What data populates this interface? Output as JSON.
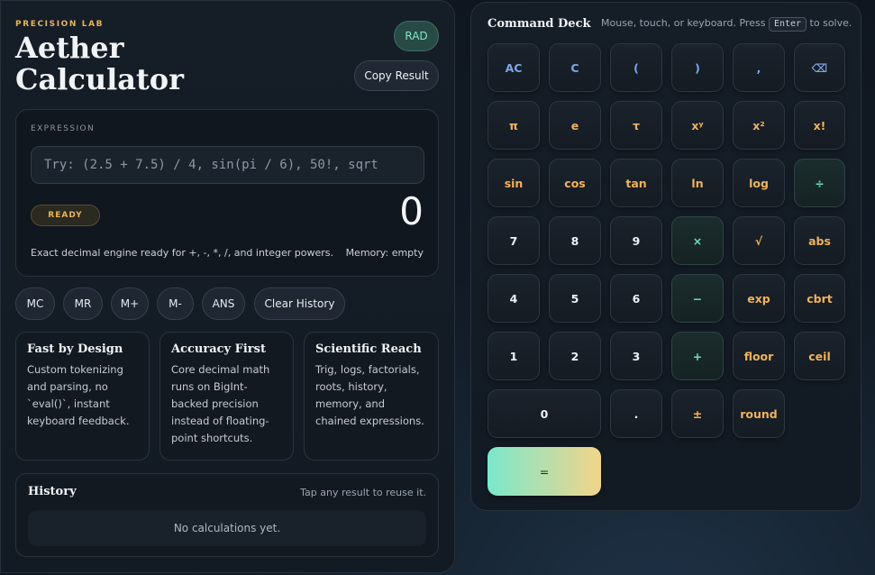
{
  "header": {
    "eyebrow": "PRECISION LAB",
    "title_line1": "Aether",
    "title_line2": "Calculator",
    "angle_mode": "RAD",
    "copy_label": "Copy Result"
  },
  "expression": {
    "label": "EXPRESSION",
    "placeholder": "Try: (2.5 + 7.5) / 4, sin(pi / 6), 50!, sqrt",
    "value": "",
    "status_badge": "READY",
    "result": "0",
    "status_text": "Exact decimal engine ready for +, -, *, /, and integer powers.",
    "memory_text": "Memory: empty"
  },
  "memory_buttons": [
    "MC",
    "MR",
    "M+",
    "M-",
    "ANS",
    "Clear History"
  ],
  "features": [
    {
      "title": "Fast by Design",
      "body": "Custom tokenizing and parsing, no `eval()`, instant keyboard feedback."
    },
    {
      "title": "Accuracy First",
      "body": "Core decimal math runs on BigInt-backed precision instead of floating-point shortcuts."
    },
    {
      "title": "Scientific Reach",
      "body": "Trig, logs, factorials, roots, history, memory, and chained expressions."
    }
  ],
  "history": {
    "title": "History",
    "hint": "Tap any result to reuse it.",
    "empty": "No calculations yet."
  },
  "deck": {
    "title": "Command Deck",
    "hint_before": "Mouse, touch, or keyboard. Press",
    "hint_key": "Enter",
    "hint_after": "to solve."
  },
  "keys": [
    [
      "AC",
      "C",
      "(",
      ")",
      ",",
      "⌫"
    ],
    [
      "π",
      "e",
      "τ",
      "xʸ",
      "x²",
      "x!"
    ],
    [
      "sin",
      "cos",
      "tan",
      "ln",
      "log",
      "÷"
    ],
    [
      "7",
      "8",
      "9",
      "×",
      "√",
      "abs"
    ],
    [
      "4",
      "5",
      "6",
      "−",
      "exp",
      "cbrt"
    ],
    [
      "1",
      "2",
      "3",
      "+",
      "floor",
      "ceil"
    ],
    [
      "0",
      ".",
      "±",
      "round"
    ],
    [
      "="
    ]
  ],
  "colors": {
    "accent_gold": "#f0b25b",
    "accent_teal": "#6fdcc3",
    "accent_blue": "#7fa8e8"
  }
}
